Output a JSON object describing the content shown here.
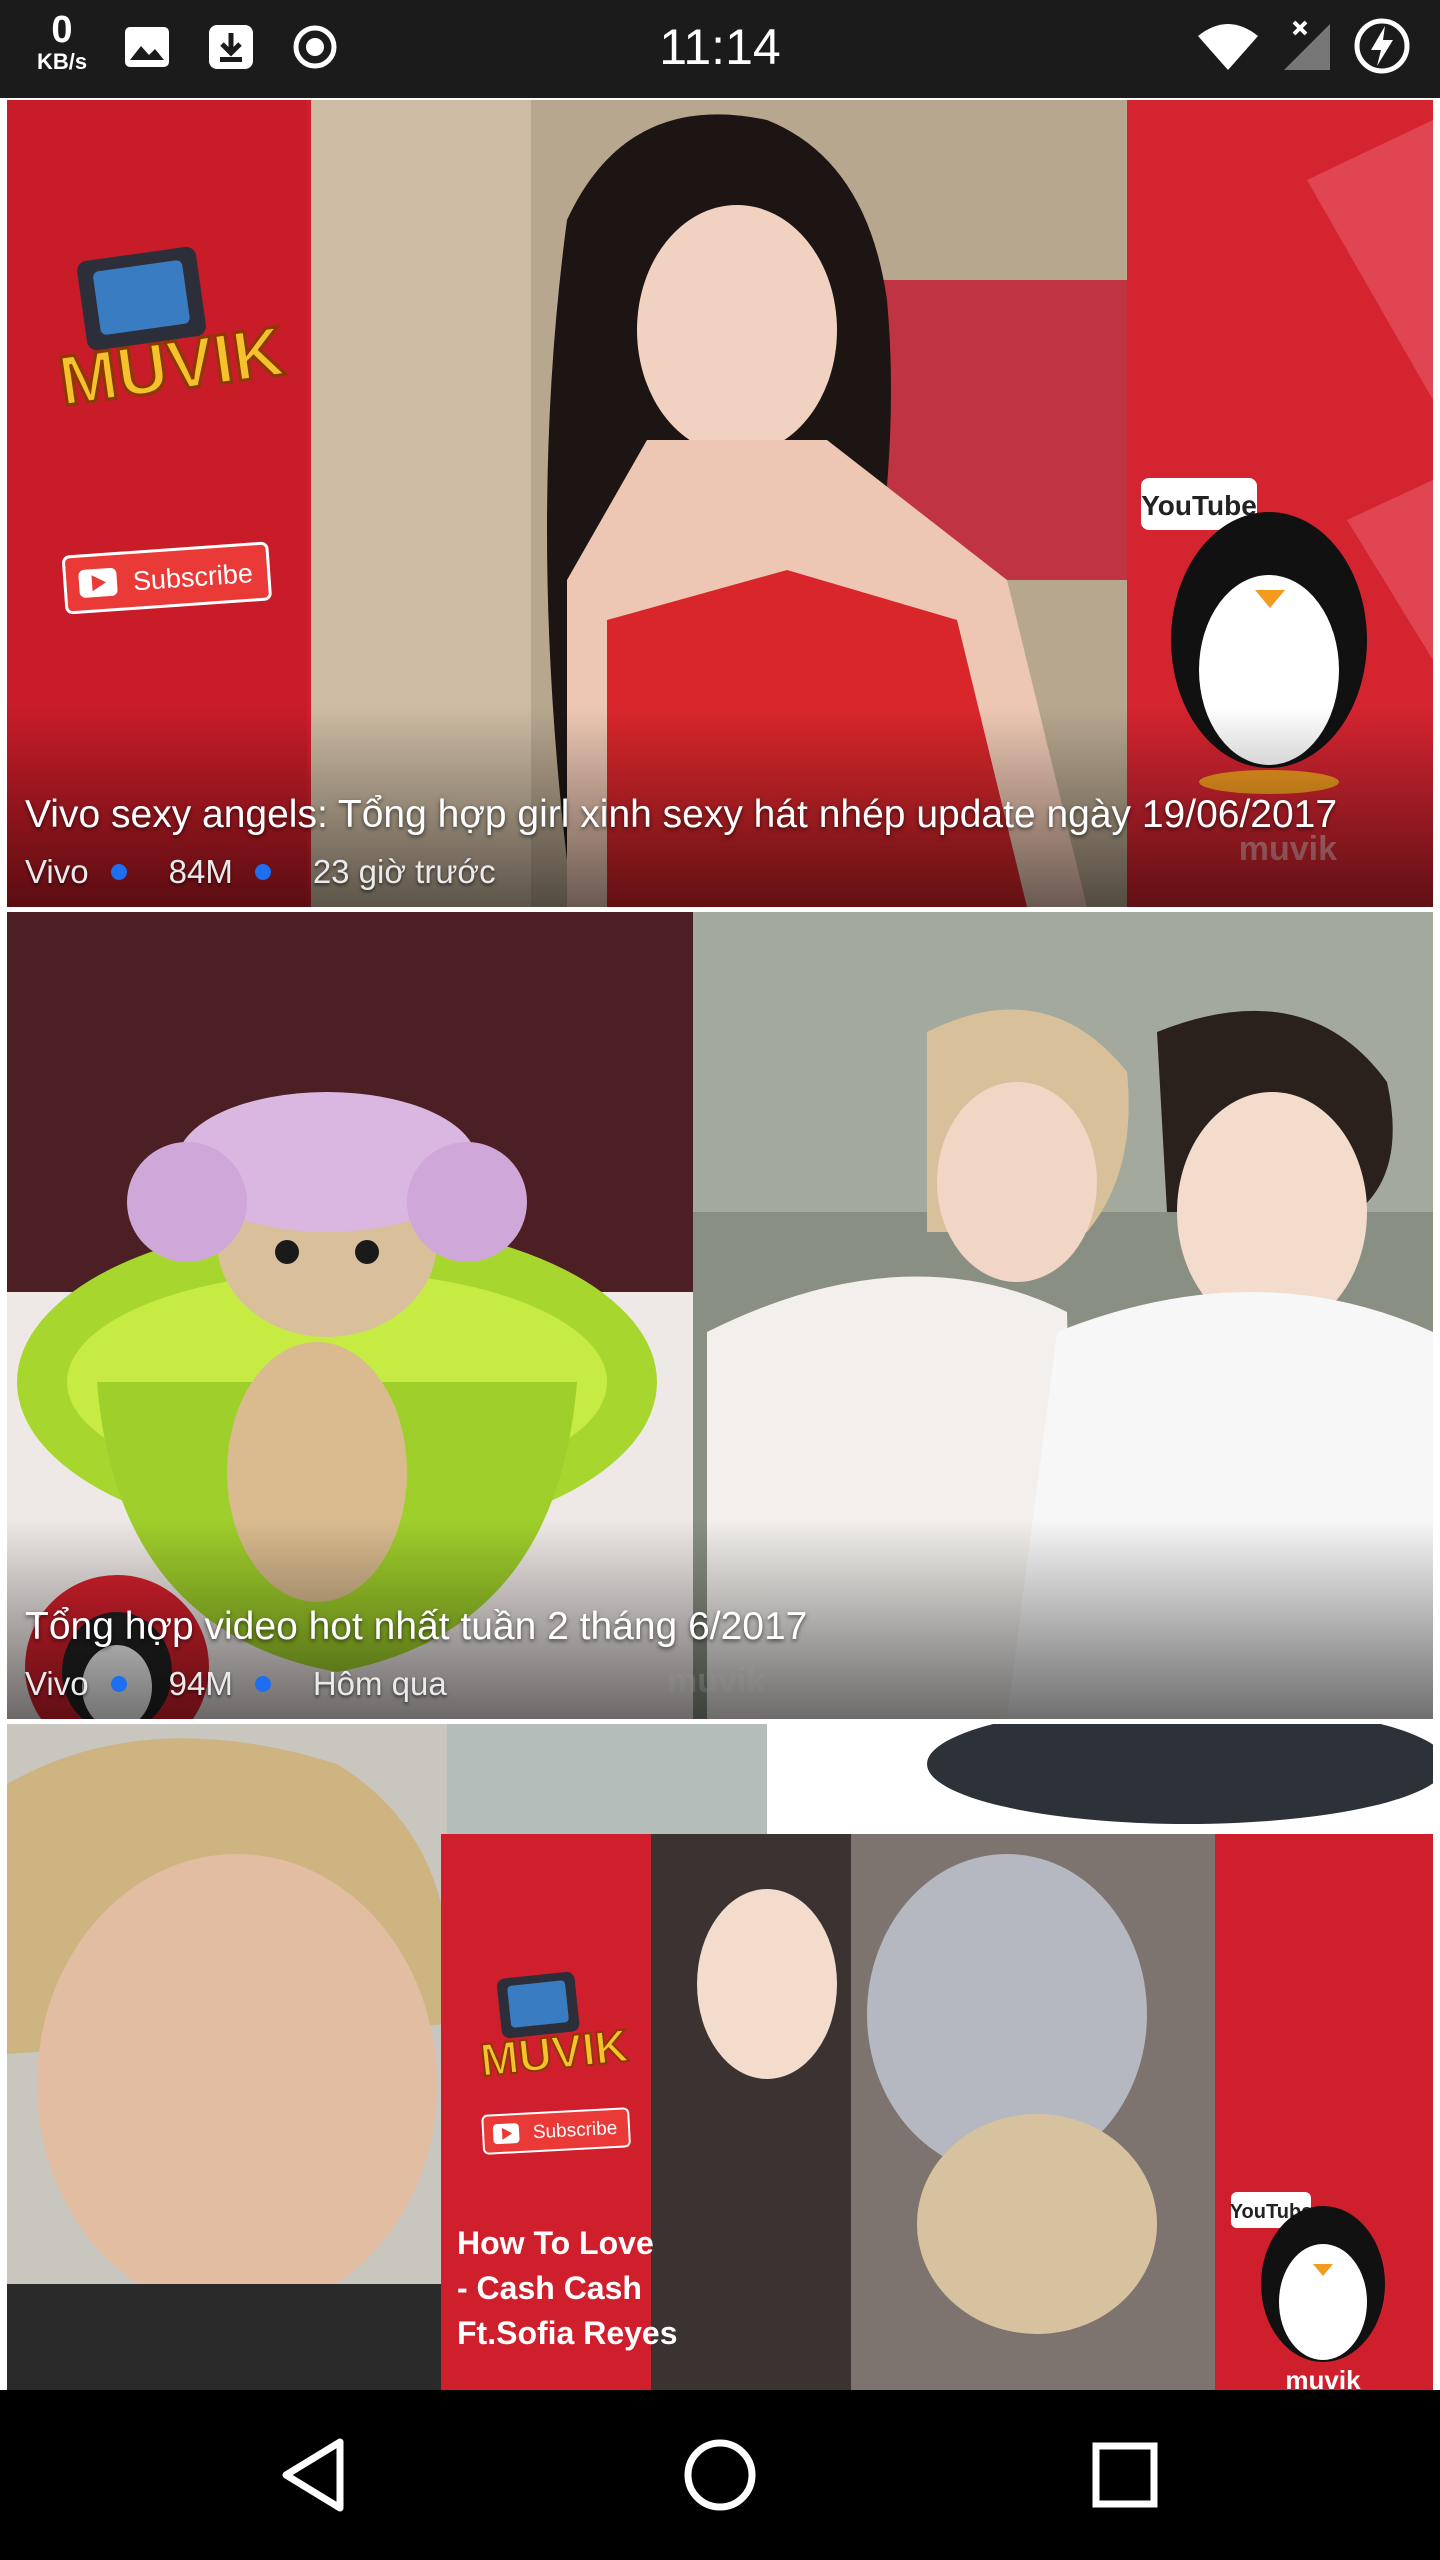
{
  "status_bar": {
    "net_speed_value": "0",
    "net_speed_unit": "KB/s",
    "time": "11:14",
    "icons": [
      "image-icon",
      "download-icon",
      "record-icon",
      "wifi-icon",
      "no-signal-icon",
      "battery-charging-icon"
    ]
  },
  "feed": {
    "videos": [
      {
        "title": "Vivo sexy angels: Tổng hợp girl xinh sexy hát nhép update ngày 19/06/2017",
        "channel": "Vivo",
        "views": "84M",
        "time": "23 giờ trước"
      },
      {
        "title": "Tổng hợp video hot nhất tuần 2 tháng 6/2017",
        "channel": "Vivo",
        "views": "94M",
        "time": "Hôm qua"
      },
      {
        "title": "",
        "channel": "",
        "views": "",
        "time": ""
      }
    ],
    "thumbnail_logo_text": "MUVIK",
    "thumbnail_subscribe_text": "Subscribe",
    "thumbnail_youtube_text": "YouTube",
    "thumbnail_watermark": "muvik",
    "thumbnail_song_text": [
      "How To Love",
      "- Cash Cash",
      "Ft.Sofia Reyes"
    ]
  },
  "nav_bar": {
    "icons": [
      "back-icon",
      "home-icon",
      "recents-icon"
    ]
  },
  "colors": {
    "status_bar_bg": "#1b1b1b",
    "meta_dot": "#1e6ff0",
    "muvik_red": "#d8202c",
    "muvik_yellow": "#f6c22b"
  }
}
